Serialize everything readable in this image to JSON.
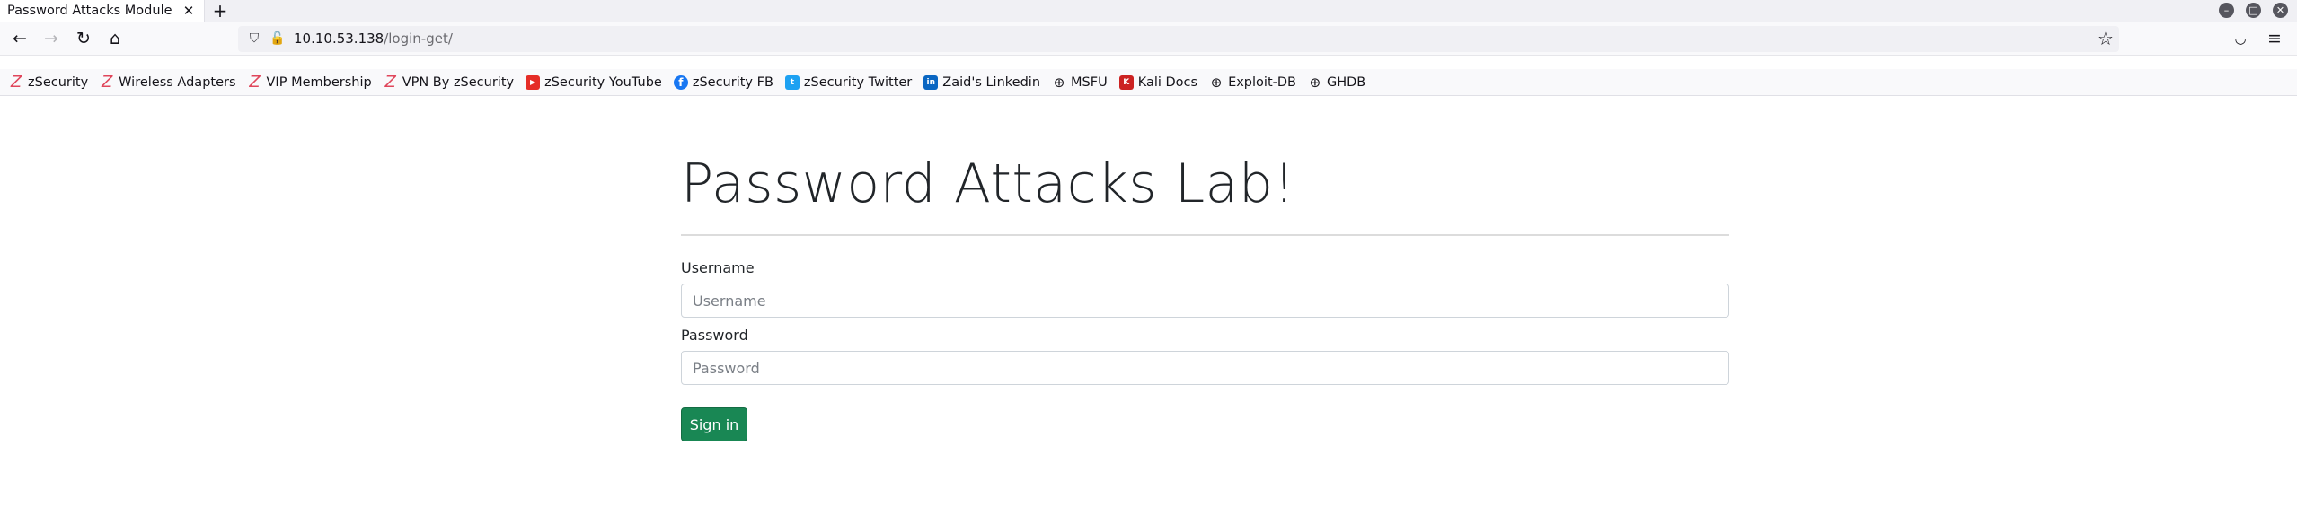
{
  "browser": {
    "tab_title": "Password Attacks Module",
    "tab_close_glyph": "✕",
    "new_tab_glyph": "+",
    "url_host": "10.10.53.138",
    "url_path": "/login-get/",
    "icons": [
      "back-icon",
      "forward-icon",
      "reload-icon",
      "home-icon",
      "shield-icon",
      "insecure-lock-icon",
      "bookmark-star-icon",
      "pocket-icon",
      "menu-icon"
    ]
  },
  "bookmarks": [
    {
      "label": "zSecurity",
      "icon": "zsecurity-icon"
    },
    {
      "label": "Wireless Adapters",
      "icon": "zsecurity-icon"
    },
    {
      "label": "VIP Membership",
      "icon": "zsecurity-icon"
    },
    {
      "label": "VPN By zSecurity",
      "icon": "zsecurity-icon"
    },
    {
      "label": "zSecurity YouTube",
      "icon": "youtube-icon"
    },
    {
      "label": "zSecurity FB",
      "icon": "facebook-icon"
    },
    {
      "label": "zSecurity Twitter",
      "icon": "twitter-icon"
    },
    {
      "label": "Zaid's Linkedin",
      "icon": "linkedin-icon"
    },
    {
      "label": "MSFU",
      "icon": "globe-icon"
    },
    {
      "label": "Kali Docs",
      "icon": "kali-icon"
    },
    {
      "label": "Exploit-DB",
      "icon": "globe-icon"
    },
    {
      "label": "GHDB",
      "icon": "globe-icon"
    }
  ],
  "page": {
    "heading": "Password Attacks Lab!",
    "username_label": "Username",
    "username_placeholder": "Username",
    "password_label": "Password",
    "password_placeholder": "Password",
    "submit_label": "Sign in"
  },
  "colors": {
    "submit_button": "#198754",
    "tab_bar": "#f0f0f4",
    "toolbar": "#f9f9fb"
  }
}
